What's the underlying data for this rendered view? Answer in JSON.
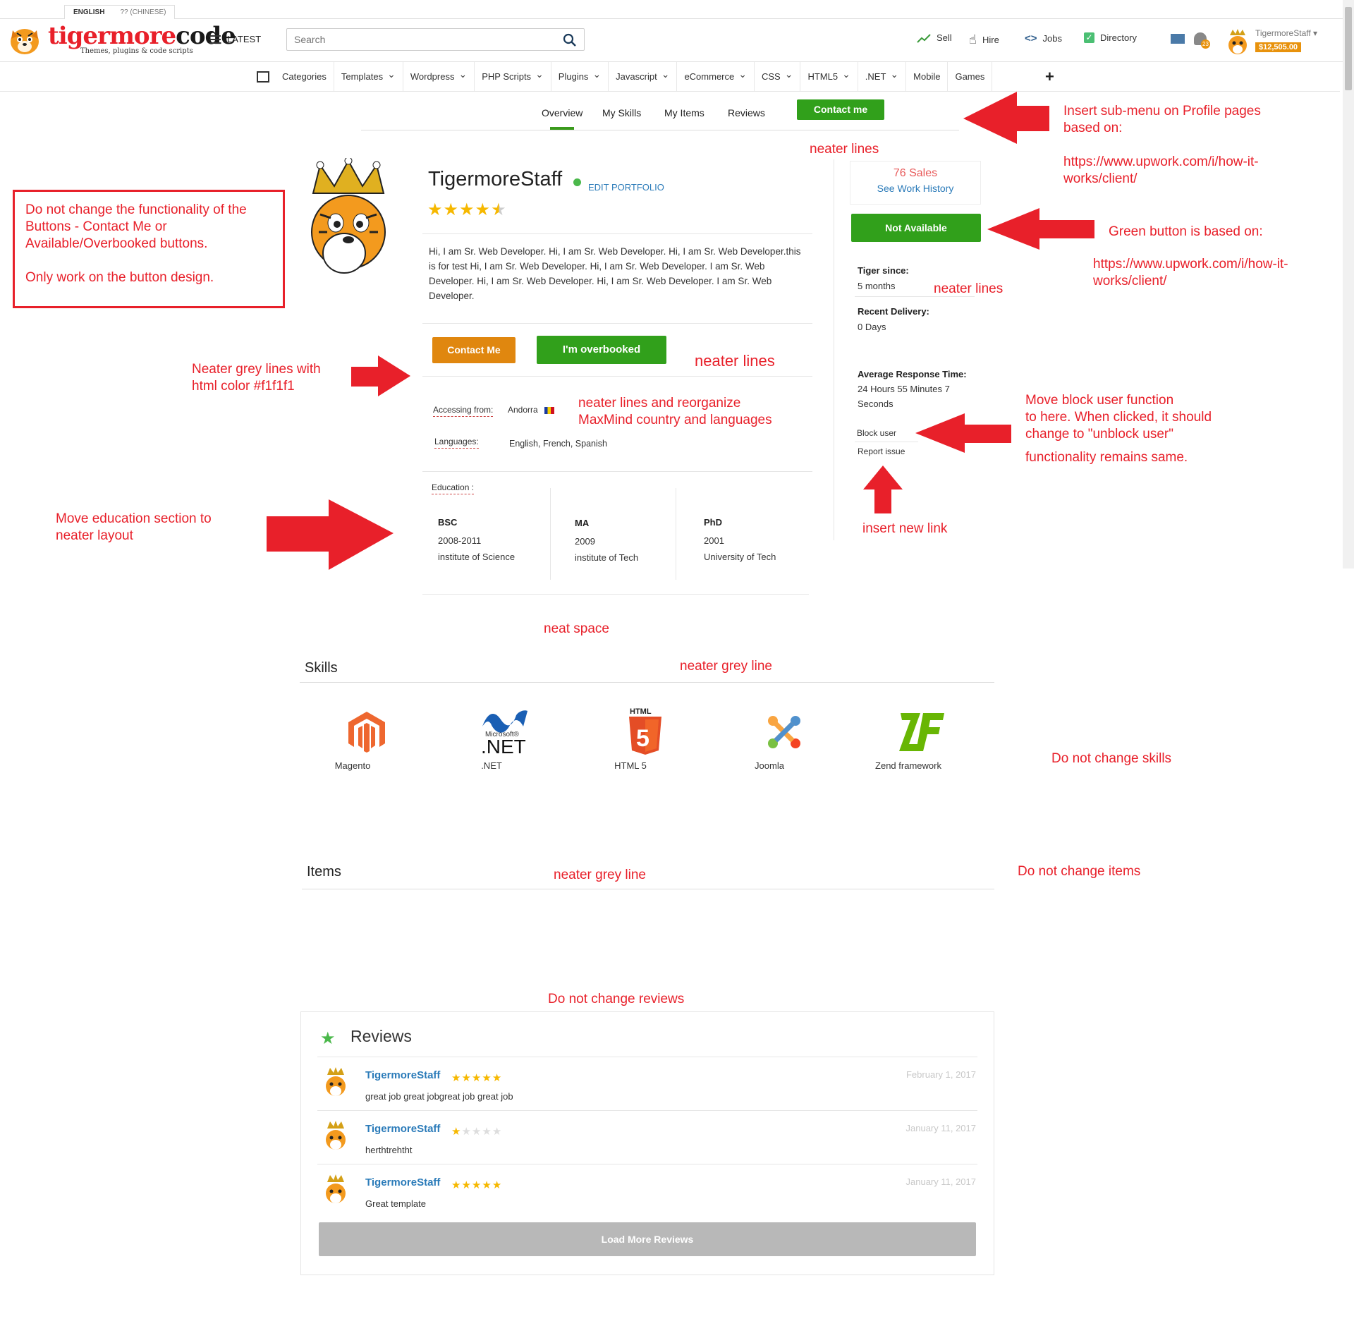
{
  "lang": {
    "english": "ENGLISH",
    "chinese": "?? (CHINESE)"
  },
  "logo": {
    "word1": "tigermore",
    "word2": "code",
    "tagline": "Themes, plugins & code scripts"
  },
  "header": {
    "latest": "LATEST",
    "search_placeholder": "Search",
    "nav": {
      "sell": "Sell",
      "hire": "Hire",
      "jobs": "Jobs",
      "directory": "Directory"
    },
    "user": {
      "name": "TigermoreStaff",
      "balance": "$12,505.00",
      "notif_count": "23"
    }
  },
  "categories": [
    "Categories",
    "Templates",
    "Wordpress",
    "PHP Scripts",
    "Plugins",
    "Javascript",
    "eCommerce",
    "CSS",
    "HTML5",
    ".NET",
    "Mobile",
    "Games"
  ],
  "profile_tabs": {
    "overview": "Overview",
    "skills": "My Skills",
    "items": "My Items",
    "reviews": "Reviews",
    "contact": "Contact me"
  },
  "profile": {
    "name": "TigermoreStaff",
    "edit": "EDIT PORTFOLIO",
    "rating": 4.5,
    "bio": "Hi, I am Sr. Web Developer. Hi, I am Sr. Web Developer. Hi, I am Sr. Web Developer.this is for test Hi, I am Sr. Web Developer. Hi, I am Sr. Web Developer. I am Sr. Web Developer. Hi, I am Sr. Web Developer. Hi, I am Sr. Web Developer. I am Sr. Web Developer.",
    "contact_btn": "Contact Me",
    "overbooked_btn": "I'm overbooked",
    "accessing_label": "Accessing from:",
    "accessing_value": "Andorra",
    "languages_label": "Languages:",
    "languages_value": "English, French, Spanish",
    "education_label": "Education :",
    "education": [
      {
        "degree": "BSC",
        "years": "2008-2011",
        "school": "institute of Science"
      },
      {
        "degree": "MA",
        "years": "2009",
        "school": "institute of Tech"
      },
      {
        "degree": "PhD",
        "years": "2001",
        "school": "University of Tech"
      }
    ]
  },
  "sidebar": {
    "sales": "76 Sales",
    "history": "See Work History",
    "availability_btn": "Not Available",
    "tiger_since_label": "Tiger since:",
    "tiger_since_value": "5 months",
    "recent_delivery_label": "Recent Delivery:",
    "recent_delivery_value": "0 Days",
    "response_label": "Average Response Time:",
    "response_value_1": "24 Hours 55 Minutes 7",
    "response_value_2": "Seconds",
    "block_user": "Block user",
    "report_issue": "Report issue"
  },
  "skills": {
    "title": "Skills",
    "items": [
      {
        "name": "Magento",
        "logo_text": ""
      },
      {
        "name": ".NET",
        "logo_text": "Microsoft® .NET"
      },
      {
        "name": "HTML 5",
        "logo_text": "HTML 5"
      },
      {
        "name": "Joomla",
        "logo_text": ""
      },
      {
        "name": "Zend framework",
        "logo_text": "ZF"
      }
    ]
  },
  "items_title": "Items",
  "reviews": {
    "title": "Reviews",
    "list": [
      {
        "name": "TigermoreStaff",
        "stars": 5,
        "text": "great job great jobgreat job great job",
        "date": "February 1, 2017"
      },
      {
        "name": "TigermoreStaff",
        "stars": 1,
        "text": "herthtrehtht",
        "date": "January 11, 2017"
      },
      {
        "name": "TigermoreStaff",
        "stars": 5,
        "text": "Great template",
        "date": "January 11, 2017"
      }
    ],
    "load_more": "Load More Reviews"
  },
  "annotations": {
    "submenu_1": "Insert sub-menu on Profile pages",
    "submenu_2": "based on:",
    "submenu_url_1": "https://www.upwork.com/i/how-it-",
    "submenu_url_2": "works/client/",
    "neater_lines": "neater lines",
    "buttons_note_1": "Do not change the functionality of the",
    "buttons_note_2": "Buttons - Contact Me or",
    "buttons_note_3": "Available/Overbooked buttons.",
    "buttons_note_4": "Only work on the button design.",
    "green_btn": "Green button is based on:",
    "green_url_1": "https://www.upwork.com/i/how-it-",
    "green_url_2": "works/client/",
    "grey_lines_1": "Neater grey lines with",
    "grey_lines_2": "html color #f1f1f1",
    "maxmind_1": "neater lines and reorganize",
    "maxmind_2": "MaxMind country and languages",
    "block_1": "Move block user function",
    "block_2": "to here. When clicked, it should",
    "block_3": "change to \"unblock user\"",
    "block_4": "functionality remains same.",
    "education_1": "Move education section to",
    "education_2": "neater layout",
    "insert_link": "insert new link",
    "neat_space": "neat space",
    "neater_grey_line": "neater grey line",
    "skills_note": "Do not change skills",
    "items_note": "Do not change items",
    "reviews_note": "Do not change reviews"
  },
  "colors": {
    "green": "#31a01b",
    "orange": "#e0870f",
    "annotation_red": "#e8202a",
    "link_blue": "#2b7bb9"
  }
}
